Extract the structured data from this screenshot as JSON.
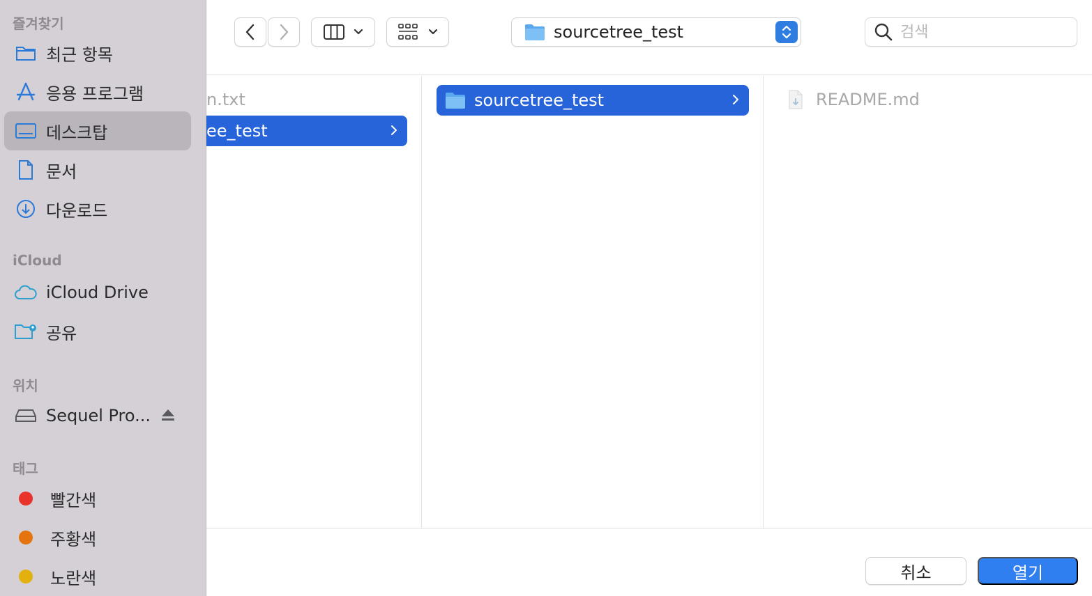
{
  "sidebar": {
    "favorites_title": "즐겨찾기",
    "favorites": [
      {
        "label": "최근 항목",
        "icon": "folder-icon"
      },
      {
        "label": "응용 프로그램",
        "icon": "apps-icon"
      },
      {
        "label": "데스크탑",
        "icon": "desktop-icon",
        "selected": true
      },
      {
        "label": "문서",
        "icon": "document-icon"
      },
      {
        "label": "다운로드",
        "icon": "download-icon"
      }
    ],
    "icloud_title": "iCloud",
    "icloud": [
      {
        "label": "iCloud Drive",
        "icon": "cloud-icon"
      },
      {
        "label": "공유",
        "icon": "shared-folder-icon"
      }
    ],
    "locations_title": "위치",
    "locations": [
      {
        "label": "Sequel Pro...",
        "icon": "disk-icon"
      }
    ],
    "tags_title": "태그",
    "tags": [
      {
        "label": "빨간색",
        "color": "#e8322a"
      },
      {
        "label": "주황색",
        "color": "#e5740f"
      },
      {
        "label": "노란색",
        "color": "#e3b10d"
      }
    ]
  },
  "toolbar": {
    "path_label": "sourcetree_test",
    "search_placeholder": "검색"
  },
  "columns": {
    "col1": [
      {
        "label": "n.txt",
        "dim": true
      },
      {
        "label": "ee_test",
        "selected": true
      }
    ],
    "col2": [
      {
        "label": "sourcetree_test",
        "selected": true
      }
    ],
    "col3": [
      {
        "label": "README.md",
        "dim": true
      }
    ]
  },
  "footer": {
    "cancel_label": "취소",
    "open_label": "열기"
  },
  "colors": {
    "accent": "#2864d9",
    "sidebar_bg": "#d5d0d6"
  }
}
